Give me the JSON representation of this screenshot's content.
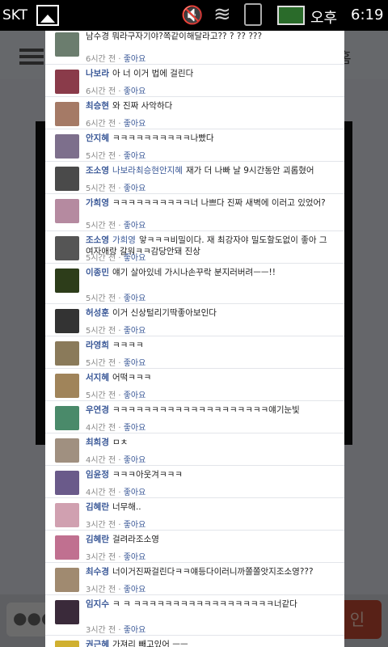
{
  "status_bar": {
    "carrier": "SKT",
    "ampm": "오후",
    "time": "6:19",
    "icons": [
      "gallery-icon",
      "mute-icon",
      "wifi-icon",
      "signal-icon",
      "battery-icon"
    ]
  },
  "background": {
    "home_label": "홈",
    "input_dots": "●●●",
    "login_label": "인"
  },
  "colors": {
    "link": "#3b5998",
    "panel_bg": "#ffffff",
    "overlay": "#000000",
    "login_button": "#c44b33"
  },
  "comments": [
    {
      "author": "",
      "tagged": "",
      "text": "남수경 뭐라구자기야?쪽같이해달라고?? ? ?? ???",
      "time": "6시간 전",
      "like": "좋아요"
    },
    {
      "author": "나보라",
      "tagged": "",
      "text": "아 너 이거 법에 걸린다",
      "time": "6시간 전",
      "like": "좋아요"
    },
    {
      "author": "최승현",
      "tagged": "",
      "text": "와 진짜 사악하다",
      "time": "6시간 전",
      "like": "좋아요"
    },
    {
      "author": "안지혜",
      "tagged": "",
      "text": "ㅋㅋㅋㅋㅋㅋㅋㅋㅋㅋ나빴다",
      "time": "5시간 전",
      "like": "좋아요"
    },
    {
      "author": "조소영",
      "tagged": "나보라최승현안지혜",
      "text": "재가 더 나빠 날 9시간동안 괴롭혔어",
      "time": "5시간 전",
      "like": "좋아요"
    },
    {
      "author": "가희영",
      "tagged": "",
      "text": "ㅋㅋㅋㅋㅋㅋㅋㅋㅋㅋ너 나쁘다 진짜 새벽에 이러고 있었어?",
      "time": "5시간 전",
      "like": "좋아요"
    },
    {
      "author": "조소영",
      "tagged": "가희영",
      "text": "앟ㅋㅋㅋ비밀이다. 재 최강자야 밀도할도없이 좋아 그 여자애랑 갈워ㅋㅋ감당안돼 진상",
      "time": "5시간 전",
      "like": "좋아요"
    },
    {
      "author": "이종민",
      "tagged": "",
      "text": "얘기 살아있네 가시나손꾸락 분지러버려ㅡㅡ!!",
      "time": "5시간 전",
      "like": "좋아요"
    },
    {
      "author": "허성훈",
      "tagged": "",
      "text": "이거 신상털리기딱좋아보인다",
      "time": "5시간 전",
      "like": "좋아요"
    },
    {
      "author": "라영희",
      "tagged": "",
      "text": "ㅋㅋㅋㅋ",
      "time": "5시간 전",
      "like": "좋아요"
    },
    {
      "author": "서지혜",
      "tagged": "",
      "text": "어떡ㅋㅋㅋ",
      "time": "5시간 전",
      "like": "좋아요"
    },
    {
      "author": "우연경",
      "tagged": "",
      "text": "ㅋㅋㅋㅋㅋㅋㅋㅋㅋㅋㅋㅋㅋㅋㅋㅋㅋㅋㅋㅋ얘기눈빛",
      "time": "4시간 전",
      "like": "좋아요"
    },
    {
      "author": "최희경",
      "tagged": "",
      "text": "ㅁㅊ",
      "time": "4시간 전",
      "like": "좋아요"
    },
    {
      "author": "임윤정",
      "tagged": "",
      "text": "ㅋㅋㅋ아웃겨ㅋㅋㅋ",
      "time": "4시간 전",
      "like": "좋아요"
    },
    {
      "author": "김혜란",
      "tagged": "",
      "text": "너무해..",
      "time": "3시간 전",
      "like": "좋아요"
    },
    {
      "author": "김혜란",
      "tagged": "",
      "text": "걸려라조소영",
      "time": "3시간 전",
      "like": "좋아요"
    },
    {
      "author": "최수경",
      "tagged": "",
      "text": "너이거진짜걸린다ㅋㅋ얘등다이러니까쫄쫄앗지조소영???",
      "time": "3시간 전",
      "like": "좋아요"
    },
    {
      "author": "임지수",
      "tagged": "",
      "text": "ㅋ ㅋ ㅋㅋㅋㅋㅋㅋㅋㅋㅋㅋㅋㅋㅋㅋㅋㅋㅋㅋ너같다",
      "time": "3시간 전",
      "like": "좋아요"
    },
    {
      "author": "권근혜",
      "tagged": "",
      "text": "가져리 빼고있어 ㅡㅡ",
      "time": "",
      "like": ""
    }
  ]
}
